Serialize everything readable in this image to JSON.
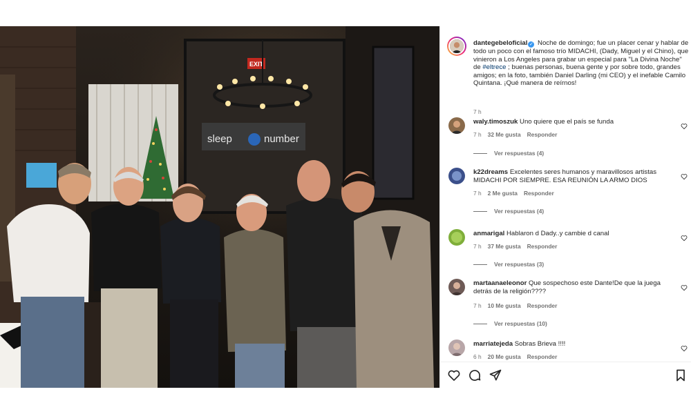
{
  "post": {
    "image_alt": "Group photo of six men standing in a restaurant with a Christmas tree and chandelier",
    "author": {
      "username": "dantegebeloficial",
      "verified_icon": "verified-badge-icon"
    },
    "caption": {
      "text_before": "Noche de domingo; fue un placer cenar y hablar de todo un poco con el famoso trío MIDACHI, (Dady, Miguel y el Chino), que vinieron a Los Angeles para grabar un especial para \"La Divina Noche\" de ",
      "hashtag": "#eltrece",
      "text_after": " ; buenas personas, buena gente y por sobre todo, grandes amigos; en la foto, también Daniel Darling (mi CEO) y el inefable Camilo Quintana. ¡Qué manera de reírnos!",
      "time": "7 h"
    },
    "photo_sign": {
      "exit": "EXIT",
      "store_left": "sleep",
      "store_right": "number"
    }
  },
  "comments": [
    {
      "username": "waly.timoszuk",
      "text": "Uno quiere que el país se funda",
      "time": "7 h",
      "likes": "32 Me gusta",
      "reply": "Responder",
      "replies": "Ver respuestas (4)",
      "avatar_color": "#8a6a4a"
    },
    {
      "username": "k22dreams",
      "text": "Excelentes seres humanos y maravillosos artistas MIDACHI POR SIEMPRE. ESA REUNIÓN LA ARMO DIOS",
      "time": "7 h",
      "likes": "2 Me gusta",
      "reply": "Responder",
      "replies": "Ver respuestas (4)",
      "avatar_color": "#3b4f8a"
    },
    {
      "username": "anmarigal",
      "text": "Hablaron d Dady..y cambie d canal",
      "time": "7 h",
      "likes": "37 Me gusta",
      "reply": "Responder",
      "replies": "Ver respuestas (3)",
      "avatar_color": "#7fae3a"
    },
    {
      "username": "martaanaeleonor",
      "text": "Que sospechoso este Dante!De que la juega detrás de la religión????",
      "time": "7 h",
      "likes": "10 Me gusta",
      "reply": "Responder",
      "replies": "Ver respuestas (10)",
      "avatar_color": "#6e5a56"
    },
    {
      "username": "marriatejeda",
      "text": "Sobras Brieva !!!!",
      "time": "6 h",
      "likes": "20 Me gusta",
      "reply": "Responder",
      "replies": "",
      "avatar_color": "#b8a6a8"
    }
  ],
  "actions": {
    "like_icon": "heart-icon",
    "comment_icon": "comment-icon",
    "share_icon": "share-icon",
    "save_icon": "bookmark-icon"
  },
  "colors": {
    "link": "#00376b",
    "muted": "#737373",
    "verified": "#3897f0"
  }
}
